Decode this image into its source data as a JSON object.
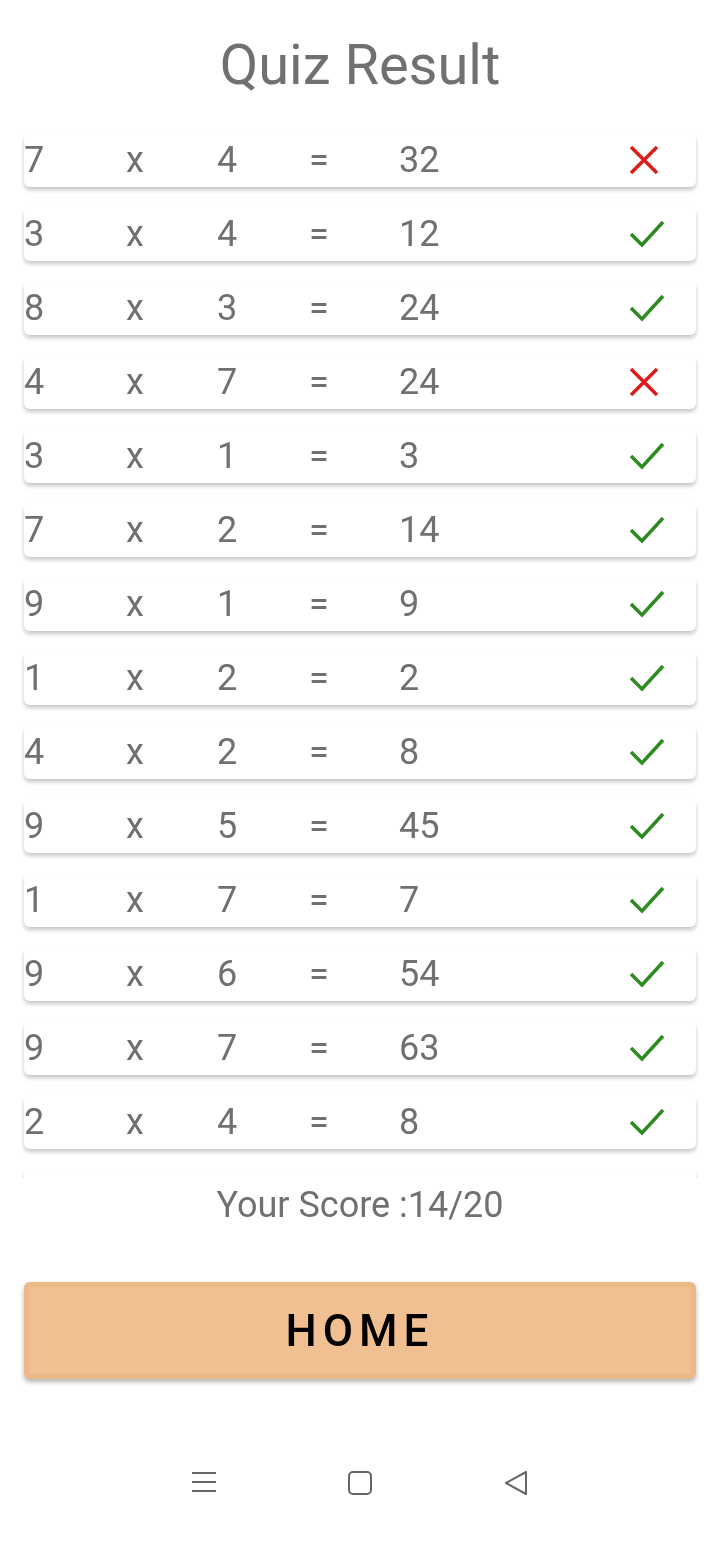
{
  "title": "Quiz Result",
  "rows": [
    {
      "a": "7",
      "op": "x",
      "b": "4",
      "eq": "=",
      "answer": "32",
      "correct": false
    },
    {
      "a": "3",
      "op": "x",
      "b": "4",
      "eq": "=",
      "answer": "12",
      "correct": true
    },
    {
      "a": "8",
      "op": "x",
      "b": "3",
      "eq": "=",
      "answer": "24",
      "correct": true
    },
    {
      "a": "4",
      "op": "x",
      "b": "7",
      "eq": "=",
      "answer": "24",
      "correct": false
    },
    {
      "a": "3",
      "op": "x",
      "b": "1",
      "eq": "=",
      "answer": "3",
      "correct": true
    },
    {
      "a": "7",
      "op": "x",
      "b": "2",
      "eq": "=",
      "answer": "14",
      "correct": true
    },
    {
      "a": "9",
      "op": "x",
      "b": "1",
      "eq": "=",
      "answer": "9",
      "correct": true
    },
    {
      "a": "1",
      "op": "x",
      "b": "2",
      "eq": "=",
      "answer": "2",
      "correct": true
    },
    {
      "a": "4",
      "op": "x",
      "b": "2",
      "eq": "=",
      "answer": "8",
      "correct": true
    },
    {
      "a": "9",
      "op": "x",
      "b": "5",
      "eq": "=",
      "answer": "45",
      "correct": true
    },
    {
      "a": "1",
      "op": "x",
      "b": "7",
      "eq": "=",
      "answer": "7",
      "correct": true
    },
    {
      "a": "9",
      "op": "x",
      "b": "6",
      "eq": "=",
      "answer": "54",
      "correct": true
    },
    {
      "a": "9",
      "op": "x",
      "b": "7",
      "eq": "=",
      "answer": "63",
      "correct": true
    },
    {
      "a": "2",
      "op": "x",
      "b": "4",
      "eq": "=",
      "answer": "8",
      "correct": true
    }
  ],
  "score": "Your Score :14/20",
  "home_button": "HOME"
}
